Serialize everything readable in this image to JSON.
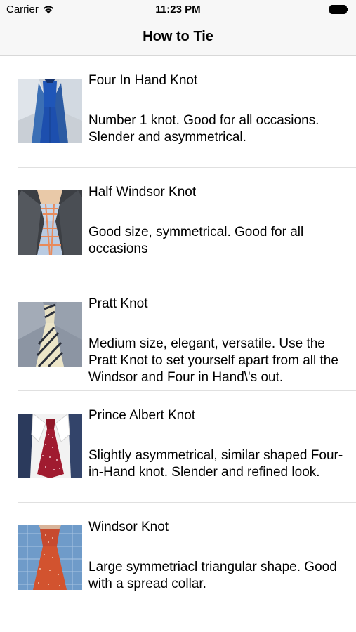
{
  "status_bar": {
    "carrier": "Carrier",
    "time": "11:23 PM",
    "wifi_icon": "wifi-icon",
    "battery_icon": "battery-icon"
  },
  "nav": {
    "title": "How to Tie"
  },
  "knots": [
    {
      "name": "Four In Hand Knot",
      "description": "Number 1 knot. Good for all occasions. Slender and asymmetrical.",
      "image": "four-in-hand-tie-image"
    },
    {
      "name": "Half Windsor Knot",
      "description": "Good size, symmetrical. Good for all occasions",
      "image": "half-windsor-tie-image"
    },
    {
      "name": "Pratt Knot",
      "description": "Medium size, elegant, versatile. Use the Pratt Knot to set yourself apart from all the Windsor and Four in Hand\\'s out.",
      "image": "pratt-tie-image"
    },
    {
      "name": "Prince Albert Knot",
      "description": "Slightly asymmetrical, similar shaped Four-in-Hand knot. Slender and refined look.",
      "image": "prince-albert-tie-image"
    },
    {
      "name": "Windsor Knot",
      "description": "Large symmetriacl triangular shape. Good with a spread collar.",
      "image": "windsor-tie-image"
    }
  ],
  "colors": {
    "bar_background": "#f7f7f7",
    "separator": "#e0e0e0",
    "text": "#000000"
  }
}
